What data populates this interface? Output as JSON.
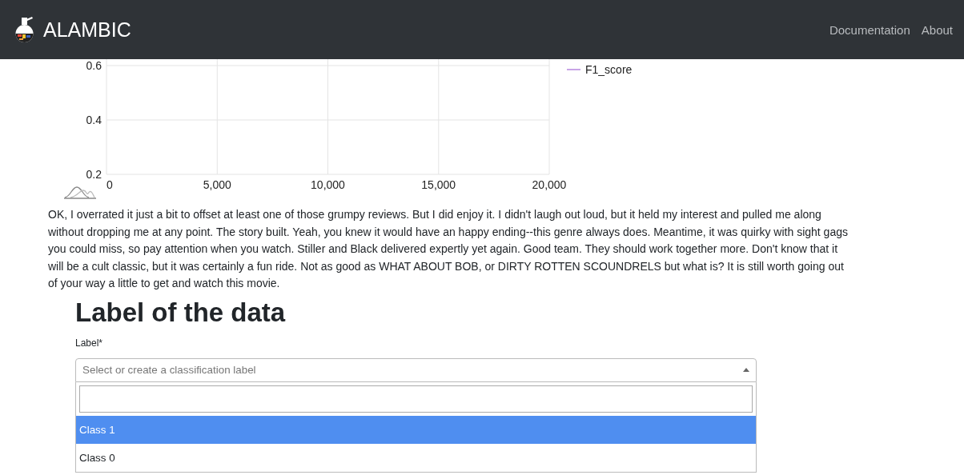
{
  "navbar": {
    "brand": "ALAMBIC",
    "links": [
      "Documentation",
      "About"
    ]
  },
  "chart": {
    "chart_data": {
      "type": "line",
      "grid": true,
      "categories": [
        "0",
        "5,000",
        "10,000",
        "15,000",
        "20,000"
      ],
      "ylim": [
        0.2,
        0.6
      ],
      "yticks": [
        {
          "value": 0.2,
          "label": "0.2"
        },
        {
          "value": 0.4,
          "label": "0.4"
        },
        {
          "value": 0.6,
          "label": "0.6"
        }
      ],
      "series": [
        {
          "name": "F1_score",
          "color": "#c8a4e6",
          "values": [
            null,
            null,
            null,
            null,
            null
          ]
        }
      ]
    }
  },
  "text": "OK, I overrated it just a bit to offset at least one of those grumpy reviews. But I did enjoy it. I didn't laugh out loud, but it held my interest and pulled me along without dropping me at any point. The story built. Yeah, you knew it would have an happy ending--this genre always does. Meantime, it was quirky with sight gags you could miss, so pay attention when you watch. Stiller and Black delivered expertly yet again. Good team. They should work together more. Don't know that it will be a cult classic, but it was certainly a fun ride. Not as good as WHAT ABOUT BOB, or DIRTY ROTTEN SCOUNDRELS but what is? It is still worth going out of your way a little to get and watch this movie.",
  "form": {
    "heading": "Label of the data",
    "label": "Label*",
    "select": {
      "placeholder": "Select or create a classification label",
      "expanded": true,
      "options": [
        {
          "label": "Class 1",
          "selected": true
        },
        {
          "label": "Class 0",
          "selected": false
        }
      ]
    }
  }
}
